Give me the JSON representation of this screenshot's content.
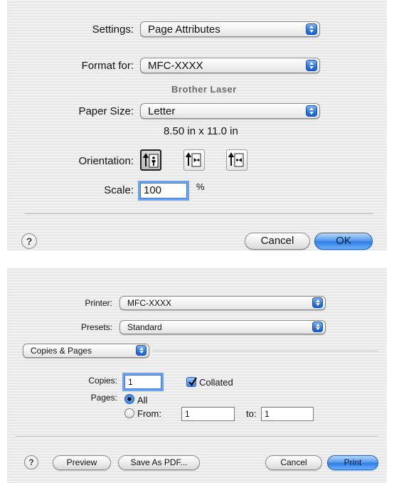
{
  "page_setup": {
    "settings": {
      "label": "Settings:",
      "value": "Page Attributes"
    },
    "format_for": {
      "label": "Format for:",
      "value": "MFC-XXXX",
      "subtitle": "Brother Laser"
    },
    "paper_size": {
      "label": "Paper Size:",
      "value": "Letter",
      "dimensions": "8.50 in x 11.0 in"
    },
    "orientation": {
      "label": "Orientation:",
      "options": [
        {
          "icon": "portrait-orientation-icon",
          "selected": true
        },
        {
          "icon": "landscape-left-orientation-icon",
          "selected": false
        },
        {
          "icon": "landscape-right-orientation-icon",
          "selected": false
        }
      ]
    },
    "scale": {
      "label": "Scale:",
      "value": "100",
      "unit": "%"
    },
    "buttons": {
      "help": "?",
      "cancel": "Cancel",
      "ok": "OK"
    }
  },
  "print": {
    "printer": {
      "label": "Printer:",
      "value": "MFC-XXXX"
    },
    "presets": {
      "label": "Presets:",
      "value": "Standard"
    },
    "section": {
      "value": "Copies & Pages"
    },
    "copies": {
      "label": "Copies:",
      "value": "1",
      "collated_label": "Collated",
      "collated": true
    },
    "pages": {
      "label": "Pages:",
      "all_label": "All",
      "from_label": "From:",
      "from_value": "1",
      "to_label": "to:",
      "to_value": "1",
      "selected": "All"
    },
    "buttons": {
      "help": "?",
      "preview": "Preview",
      "save_pdf": "Save As PDF...",
      "cancel": "Cancel",
      "print": "Print"
    }
  }
}
